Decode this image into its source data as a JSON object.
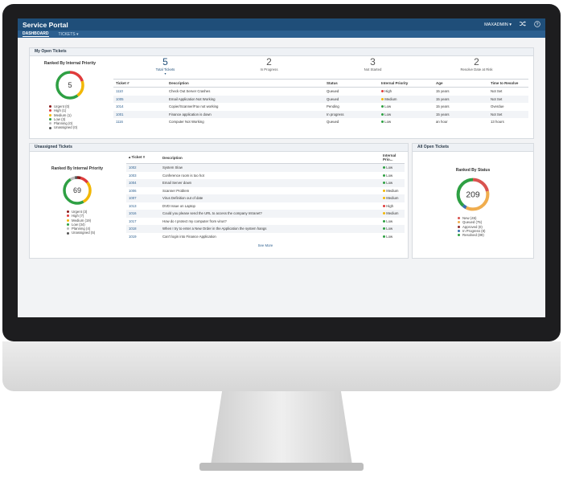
{
  "header": {
    "brand": "Service Portal",
    "user": "MAXADMIN ▾",
    "shuffle_icon": "shuffle-icon",
    "help_icon": "help-icon"
  },
  "nav": {
    "dashboard": "DASHBOARD",
    "tickets": "TICKETS ▾"
  },
  "colors": {
    "urgent": "#8b1a1a",
    "high": "#e03b3b",
    "medium": "#f2b705",
    "low": "#2ea043",
    "planning": "#bbbbbb",
    "unassigned": "#555555",
    "new": "#d9534f",
    "queued": "#f0ad4e",
    "approved": "#8e2c2c",
    "in_progress": "#3a6fb0",
    "resolved": "#2ea043"
  },
  "my_open": {
    "title": "My Open Tickets",
    "chart_title": "Ranked By Internal Priority",
    "total": "5",
    "legend": [
      "Urgent (0)",
      "High (1)",
      "Medium (1)",
      "Low (3)",
      "Planning (0)",
      "Unassigned (0)"
    ],
    "stats": [
      {
        "num": "5",
        "label": "Total Tickets"
      },
      {
        "num": "2",
        "label": "In Progress"
      },
      {
        "num": "3",
        "label": "Not Started"
      },
      {
        "num": "2",
        "label": "Resolve Date at Risk"
      }
    ],
    "columns": [
      "Ticket #",
      "Description",
      "Status",
      "Internal Priority",
      "Age",
      "Time to Resolve"
    ],
    "rows": [
      {
        "id": "1110",
        "desc": "Check Out Server Crashes",
        "status": "Queued",
        "priority": "High",
        "age": "15 years",
        "ttr": "Not Set"
      },
      {
        "id": "1005",
        "desc": "Email Application Not Working",
        "status": "Queued",
        "priority": "Medium",
        "age": "15 years",
        "ttr": "Not Set"
      },
      {
        "id": "1014",
        "desc": "Copier/Scanner/Fax not working",
        "status": "Pending",
        "priority": "Low",
        "age": "15 years",
        "ttr": "Overdue"
      },
      {
        "id": "1001",
        "desc": "Finance application is down",
        "status": "In progress",
        "priority": "Low",
        "age": "15 years",
        "ttr": "Not Set"
      },
      {
        "id": "1116",
        "desc": "Computer Not Working",
        "status": "Queued",
        "priority": "Low",
        "age": "an hour",
        "ttr": "13 hours"
      }
    ]
  },
  "unassigned": {
    "title": "Unassigned Tickets",
    "chart_title": "Ranked By Internal Priority",
    "total": "69",
    "legend": [
      "Urgent (3)",
      "High (7)",
      "Medium (19)",
      "Low (34)",
      "Planning (4)",
      "Unassigned (5)"
    ],
    "columns": [
      "▴ Ticket #",
      "Description",
      "Internal Prio..."
    ],
    "rows": [
      {
        "id": "1002",
        "desc": "System Slow",
        "priority": "Low"
      },
      {
        "id": "1003",
        "desc": "Conference room is too hot",
        "priority": "Low"
      },
      {
        "id": "1004",
        "desc": "Email Server down",
        "priority": "Low"
      },
      {
        "id": "1006",
        "desc": "Scanner Problem",
        "priority": "Medium"
      },
      {
        "id": "1007",
        "desc": "Virus Definition out of date",
        "priority": "Medium"
      },
      {
        "id": "1013",
        "desc": "DVD Issue on Laptop",
        "priority": "High"
      },
      {
        "id": "1016",
        "desc": "Could you please send the URL to access the company Intranet?",
        "priority": "Medium"
      },
      {
        "id": "1017",
        "desc": "How do I protect my computer from virus?",
        "priority": "Low"
      },
      {
        "id": "1018",
        "desc": "When I try to enter a New Order in the Application the system hangs",
        "priority": "Low"
      },
      {
        "id": "1019",
        "desc": "Can't login into Finance Application",
        "priority": "Low"
      }
    ],
    "see_more": "See More"
  },
  "all_open": {
    "title": "All Open Tickets",
    "chart_title": "Ranked By Status",
    "total": "209",
    "legend": [
      "New (45)",
      "Queued (75)",
      "Approved (0)",
      "In Progress (8)",
      "Resolved (89)"
    ]
  }
}
